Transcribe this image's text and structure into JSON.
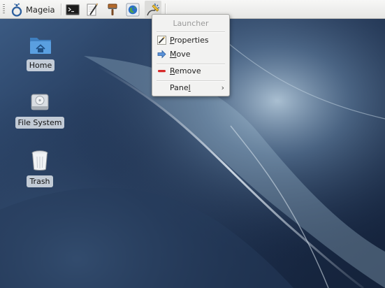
{
  "panel": {
    "app_menu_label": "Mageia",
    "launchers": [
      {
        "name": "terminal-icon"
      },
      {
        "name": "text-editor-icon"
      },
      {
        "name": "settings-brush-icon"
      },
      {
        "name": "web-browser-icon"
      },
      {
        "name": "launcher-icon"
      }
    ]
  },
  "desktop": {
    "icons": [
      {
        "label": "Home",
        "icon": "home-folder-icon"
      },
      {
        "label": "File System",
        "icon": "hard-drive-icon"
      },
      {
        "label": "Trash",
        "icon": "trash-icon"
      }
    ]
  },
  "context_menu": {
    "title": "Launcher",
    "items": [
      {
        "mnemonic": "P",
        "rest": "roperties",
        "icon": "pencil-icon"
      },
      {
        "mnemonic": "M",
        "rest": "ove",
        "icon": "arrow-right-icon"
      },
      {
        "mnemonic": "R",
        "rest": "emove",
        "icon": "remove-icon"
      },
      {
        "prefix": "Pane",
        "mnemonic": "l",
        "rest": "",
        "submenu_arrow": "›"
      }
    ]
  },
  "colors": {
    "panel_bg": "#ececea",
    "menu_bg": "#f2f2f1",
    "wallpaper_dark": "#1b2a42",
    "wallpaper_light": "#a7bfd3",
    "remove_red": "#d62a2a",
    "move_blue": "#3e78c6"
  }
}
